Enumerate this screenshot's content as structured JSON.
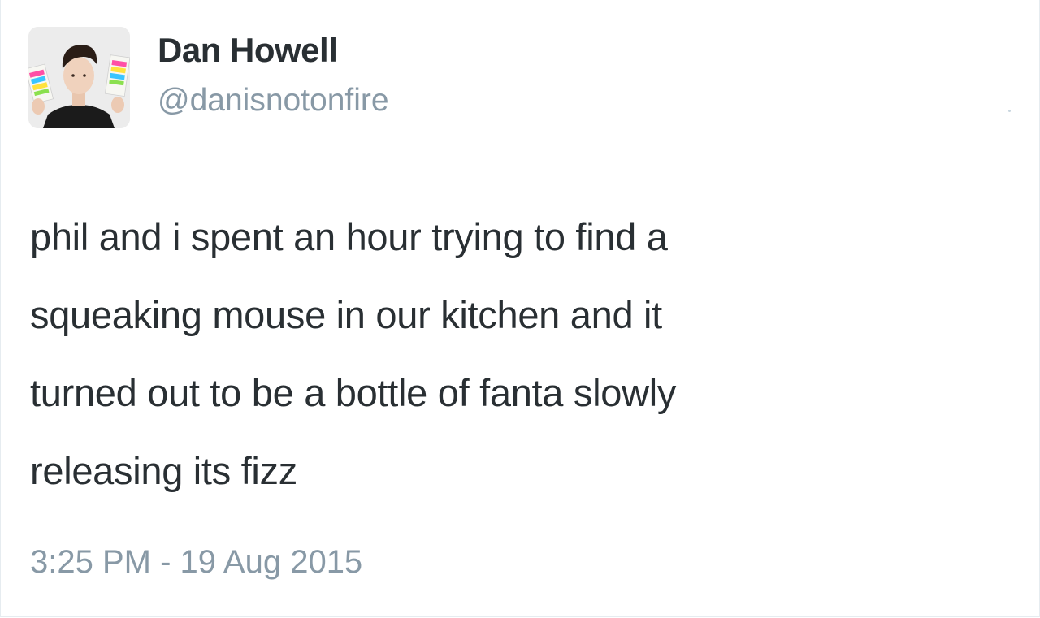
{
  "tweet": {
    "author": {
      "display_name": "Dan Howell",
      "handle": "@danisnotonfire",
      "avatar_icon": "profile-photo"
    },
    "text_lines": [
      "phil and i spent an hour trying to find a",
      "squeaking mouse in our kitchen and it",
      "turned out to be a bottle of fanta slowly",
      "releasing its fizz"
    ],
    "timestamp": "3:25 PM - 19 Aug 2015"
  },
  "colors": {
    "text_primary": "#292f33",
    "text_secondary": "#8899a6",
    "background": "#ffffff"
  }
}
